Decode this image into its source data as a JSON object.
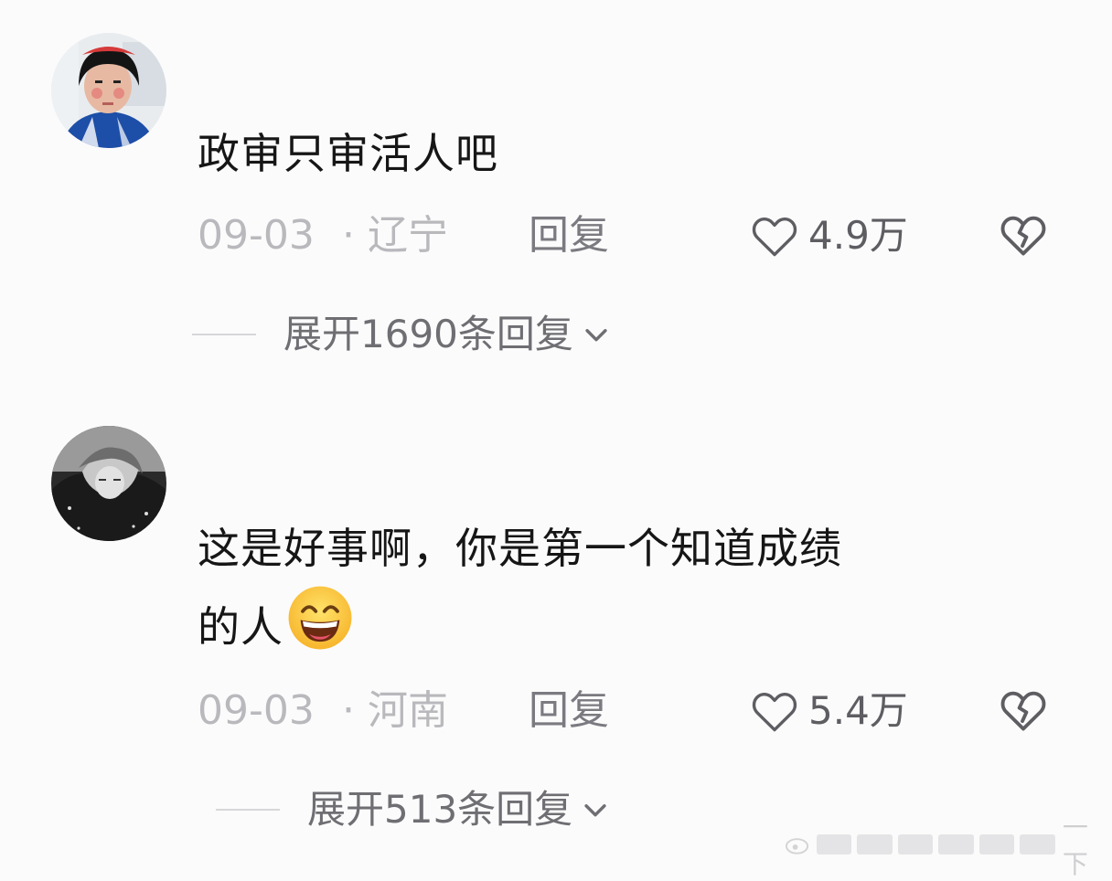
{
  "comments": [
    {
      "text": "政审只审活人吧",
      "date": "09-03",
      "location": "· 辽宁",
      "reply_label": "回复",
      "likes": "4.9万",
      "expand_label": "展开1690条回复"
    },
    {
      "text": "这是好事啊，你是第一个知道成绩",
      "text_line2": "的人",
      "date": "09-03",
      "location": "· 河南",
      "reply_label": "回复",
      "likes": "5.4万",
      "expand_label": "展开513条回复"
    }
  ],
  "watermark": {
    "text": "一下"
  }
}
